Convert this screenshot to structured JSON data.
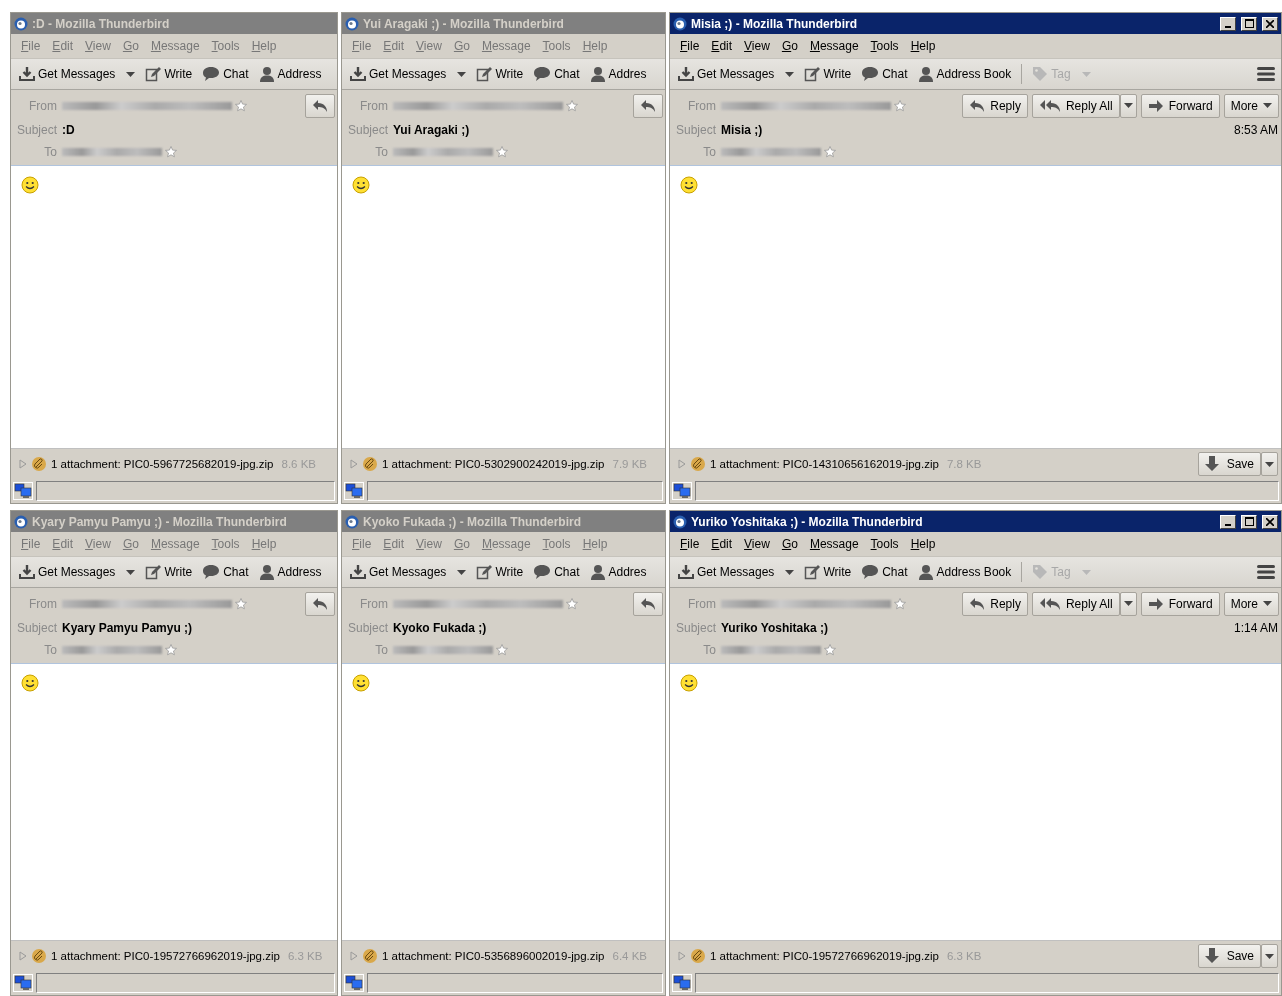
{
  "windows": [
    {
      "title": ":D - Mozilla Thunderbird",
      "active": false,
      "menu": [
        "File",
        "Edit",
        "View",
        "Go",
        "Message",
        "Tools",
        "Help"
      ],
      "toolbar": [
        {
          "kind": "get",
          "label": "Get Messages",
          "disabled": false
        },
        {
          "kind": "write",
          "label": "Write",
          "disabled": false
        },
        {
          "kind": "chat",
          "label": "Chat",
          "disabled": false
        },
        {
          "kind": "address",
          "label": "Address",
          "disabled": false
        }
      ],
      "app_menu": false,
      "header": {
        "from_label": "From",
        "subject_label": "Subject",
        "subject": ":D",
        "to_label": "To"
      },
      "header_buttons": [
        {
          "kind": "reply"
        }
      ],
      "attachment": {
        "text": "1 attachment: PIC0-5967725682019-jpg.zip",
        "size": "8.6 KB"
      }
    },
    {
      "title": "Yui Aragaki ;) - Mozilla Thunderbird",
      "active": false,
      "menu": [
        "File",
        "Edit",
        "View",
        "Go",
        "Message",
        "Tools",
        "Help"
      ],
      "toolbar": [
        {
          "kind": "get",
          "label": "Get Messages",
          "disabled": false
        },
        {
          "kind": "write",
          "label": "Write",
          "disabled": false
        },
        {
          "kind": "chat",
          "label": "Chat",
          "disabled": false
        },
        {
          "kind": "address",
          "label": "Addres",
          "disabled": false
        }
      ],
      "app_menu": false,
      "header": {
        "from_label": "From",
        "subject_label": "Subject",
        "subject": "Yui Aragaki ;)",
        "to_label": "To"
      },
      "header_buttons": [
        {
          "kind": "reply"
        }
      ],
      "attachment": {
        "text": "1 attachment: PIC0-5302900242019-jpg.zip",
        "size": "7.9 KB"
      }
    },
    {
      "title": "Misia ;) - Mozilla Thunderbird",
      "active": true,
      "menu": [
        "File",
        "Edit",
        "View",
        "Go",
        "Message",
        "Tools",
        "Help"
      ],
      "toolbar": [
        {
          "kind": "get",
          "label": "Get Messages",
          "disabled": false
        },
        {
          "kind": "write",
          "label": "Write",
          "disabled": false
        },
        {
          "kind": "chat",
          "label": "Chat",
          "disabled": false
        },
        {
          "kind": "address",
          "label": "Address Book",
          "disabled": false
        },
        {
          "kind": "tag",
          "label": "Tag",
          "disabled": true
        }
      ],
      "app_menu": true,
      "header": {
        "from_label": "From",
        "subject_label": "Subject",
        "subject": "Misia ;)",
        "to_label": "To",
        "time": "8:53 AM"
      },
      "header_buttons": [
        {
          "kind": "reply",
          "label": "Reply"
        },
        {
          "kind": "replyall",
          "label": "Reply All"
        },
        {
          "kind": "forward",
          "label": "Forward"
        },
        {
          "kind": "more",
          "label": "More"
        }
      ],
      "attachment": {
        "text": "1 attachment: PIC0-14310656162019-jpg.zip",
        "size": "7.8 KB",
        "save": "Save"
      }
    },
    {
      "title": "Kyary Pamyu Pamyu ;) - Mozilla Thunderbird",
      "active": false,
      "menu": [
        "File",
        "Edit",
        "View",
        "Go",
        "Message",
        "Tools",
        "Help"
      ],
      "toolbar": [
        {
          "kind": "get",
          "label": "Get Messages",
          "disabled": false
        },
        {
          "kind": "write",
          "label": "Write",
          "disabled": false
        },
        {
          "kind": "chat",
          "label": "Chat",
          "disabled": false
        },
        {
          "kind": "address",
          "label": "Address",
          "disabled": false
        }
      ],
      "app_menu": false,
      "header": {
        "from_label": "From",
        "subject_label": "Subject",
        "subject": "Kyary Pamyu Pamyu ;)",
        "to_label": "To"
      },
      "header_buttons": [
        {
          "kind": "reply"
        }
      ],
      "attachment": {
        "text": "1 attachment: PIC0-19572766962019-jpg.zip",
        "size": "6.3 KB"
      }
    },
    {
      "title": "Kyoko Fukada ;) - Mozilla Thunderbird",
      "active": false,
      "menu": [
        "File",
        "Edit",
        "View",
        "Go",
        "Message",
        "Tools",
        "Help"
      ],
      "toolbar": [
        {
          "kind": "get",
          "label": "Get Messages",
          "disabled": false
        },
        {
          "kind": "write",
          "label": "Write",
          "disabled": false
        },
        {
          "kind": "chat",
          "label": "Chat",
          "disabled": false
        },
        {
          "kind": "address",
          "label": "Addres",
          "disabled": false
        }
      ],
      "app_menu": false,
      "header": {
        "from_label": "From",
        "subject_label": "Subject",
        "subject": "Kyoko Fukada ;)",
        "to_label": "To"
      },
      "header_buttons": [
        {
          "kind": "reply"
        }
      ],
      "attachment": {
        "text": "1 attachment: PIC0-5356896002019-jpg.zip",
        "size": "6.4 KB"
      }
    },
    {
      "title": "Yuriko Yoshitaka ;) - Mozilla Thunderbird",
      "active": true,
      "menu": [
        "File",
        "Edit",
        "View",
        "Go",
        "Message",
        "Tools",
        "Help"
      ],
      "toolbar": [
        {
          "kind": "get",
          "label": "Get Messages",
          "disabled": false
        },
        {
          "kind": "write",
          "label": "Write",
          "disabled": false
        },
        {
          "kind": "chat",
          "label": "Chat",
          "disabled": false
        },
        {
          "kind": "address",
          "label": "Address Book",
          "disabled": false
        },
        {
          "kind": "tag",
          "label": "Tag",
          "disabled": true
        }
      ],
      "app_menu": true,
      "header": {
        "from_label": "From",
        "subject_label": "Subject",
        "subject": "Yuriko Yoshitaka ;)",
        "to_label": "To",
        "time": "1:14 AM"
      },
      "header_buttons": [
        {
          "kind": "reply",
          "label": "Reply"
        },
        {
          "kind": "replyall",
          "label": "Reply All"
        },
        {
          "kind": "forward",
          "label": "Forward"
        },
        {
          "kind": "more",
          "label": "More"
        }
      ],
      "attachment": {
        "text": "1 attachment: PIC0-19572766962019-jpg.zip",
        "size": "6.3 KB",
        "save": "Save"
      }
    }
  ]
}
